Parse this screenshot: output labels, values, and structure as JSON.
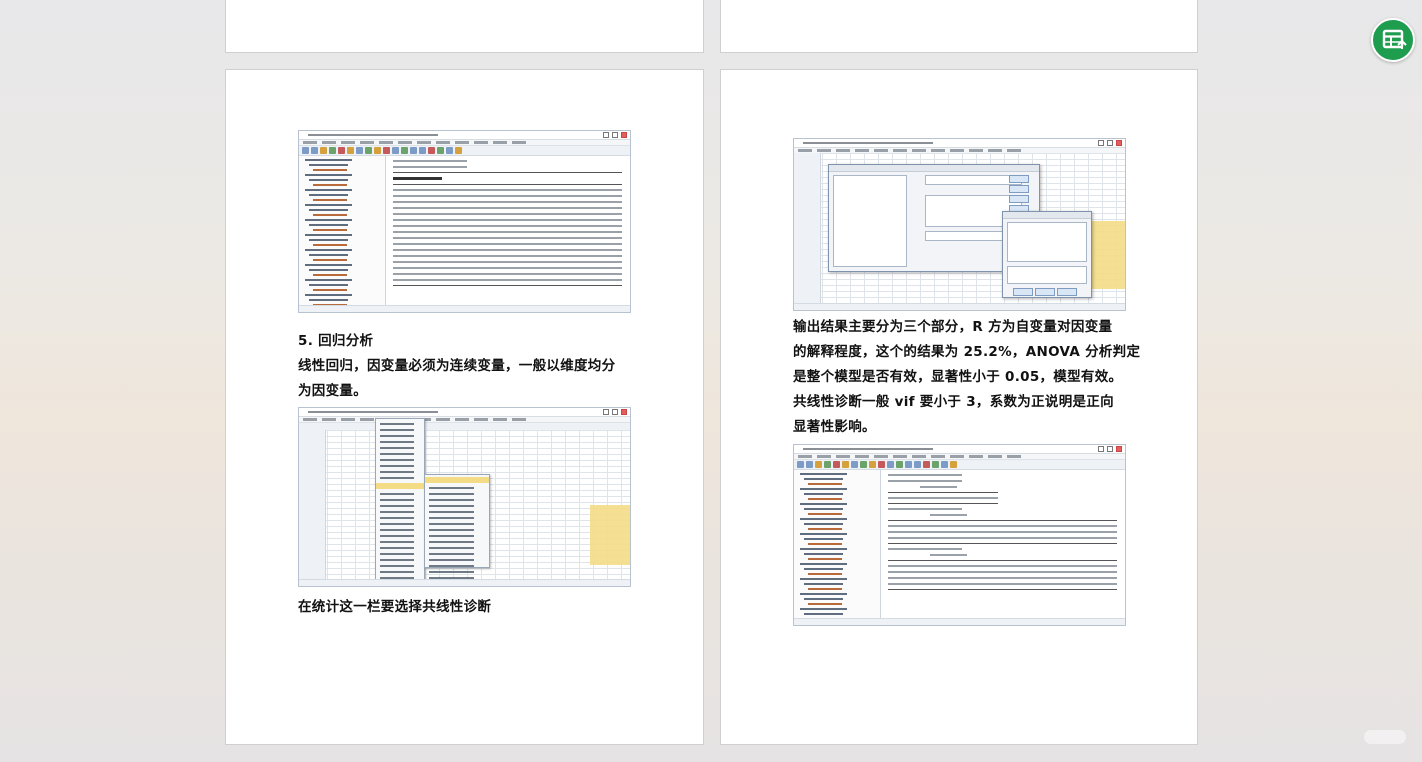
{
  "left_page": {
    "section_heading": "5. 回归分析",
    "paragraph_line1": "线性回归，因变量必须为连续变量，一般以维度均分",
    "paragraph_line2": "为因变量。",
    "caption": "在统计这一栏要选择共线性诊断"
  },
  "right_page": {
    "paragraph_lines": [
      "输出结果主要分为三个部分，R 方为自变量对因变量",
      "的解释程度，这个的结果为 25.2%，ANOVA 分析判定",
      "是整个模型是否有效，显著性小于 0.05，模型有效。",
      "共线性诊断一般 vif 要小于 3，系数为正说明是正向",
      "显著性影响。"
    ]
  },
  "icons": {
    "app_icon": "table-icon",
    "app_icon_color": "#1f9d4f"
  }
}
